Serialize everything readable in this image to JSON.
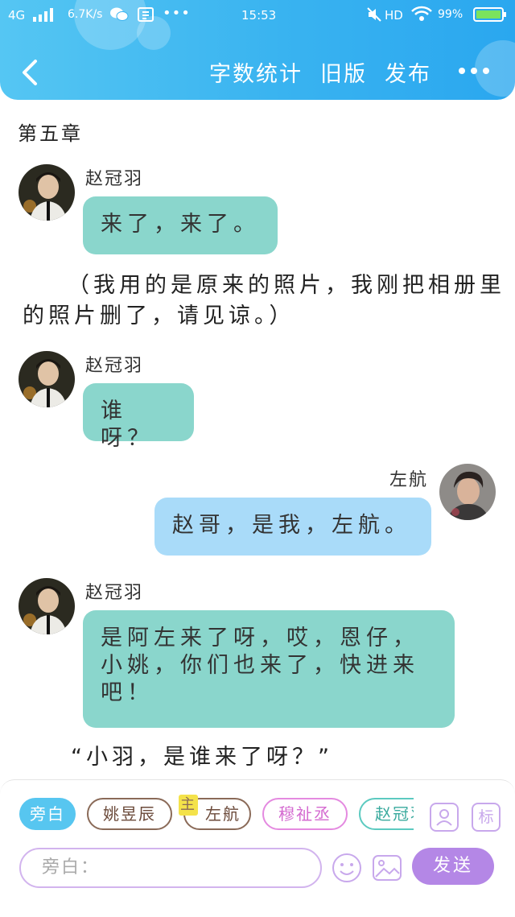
{
  "status_bar": {
    "network": "4G",
    "speed": "6.7K/s",
    "time": "15:53",
    "hd": "HD",
    "battery": "99%"
  },
  "header": {
    "back_icon": "chevron-left-icon",
    "word_count": "字数统计",
    "old_version": "旧版",
    "publish": "发布",
    "more_icon": "more-dots-icon"
  },
  "chapter_title": "第五章",
  "messages": [
    {
      "type": "left",
      "name": "赵冠羽",
      "text": "来了，来了。"
    },
    {
      "type": "narration",
      "text": "（我用的是原来的照片，我刚把相册里的照片删了，请见谅。）"
    },
    {
      "type": "left",
      "name": "赵冠羽",
      "text": "谁呀？"
    },
    {
      "type": "right",
      "name": "左航",
      "text": "赵哥，是我，左航。"
    },
    {
      "type": "left",
      "name": "赵冠羽",
      "text": "是阿左来了呀，哎，恩仔，小姚，你们也来了，快进来吧！"
    },
    {
      "type": "narration",
      "text": "“小羽，是谁来了呀？”"
    }
  ],
  "bottom_bar": {
    "roles": [
      {
        "label": "旁白",
        "selected": true
      },
      {
        "label": "姚昱辰"
      },
      {
        "label": "左航",
        "badge": "主"
      },
      {
        "label": "穆祉丞"
      },
      {
        "label": "赵冠羽"
      }
    ],
    "role_icon": "person-card-icon",
    "tag_label": "标",
    "input_placeholder": "旁白：",
    "emoji_icon": "smile-icon",
    "image_icon": "image-icon",
    "send_label": "发送"
  },
  "colors": {
    "header": "#39b3f0",
    "left_bubble": "#8ad6cc",
    "right_bubble": "#a9dbf9",
    "send_button": "#b487e6"
  }
}
